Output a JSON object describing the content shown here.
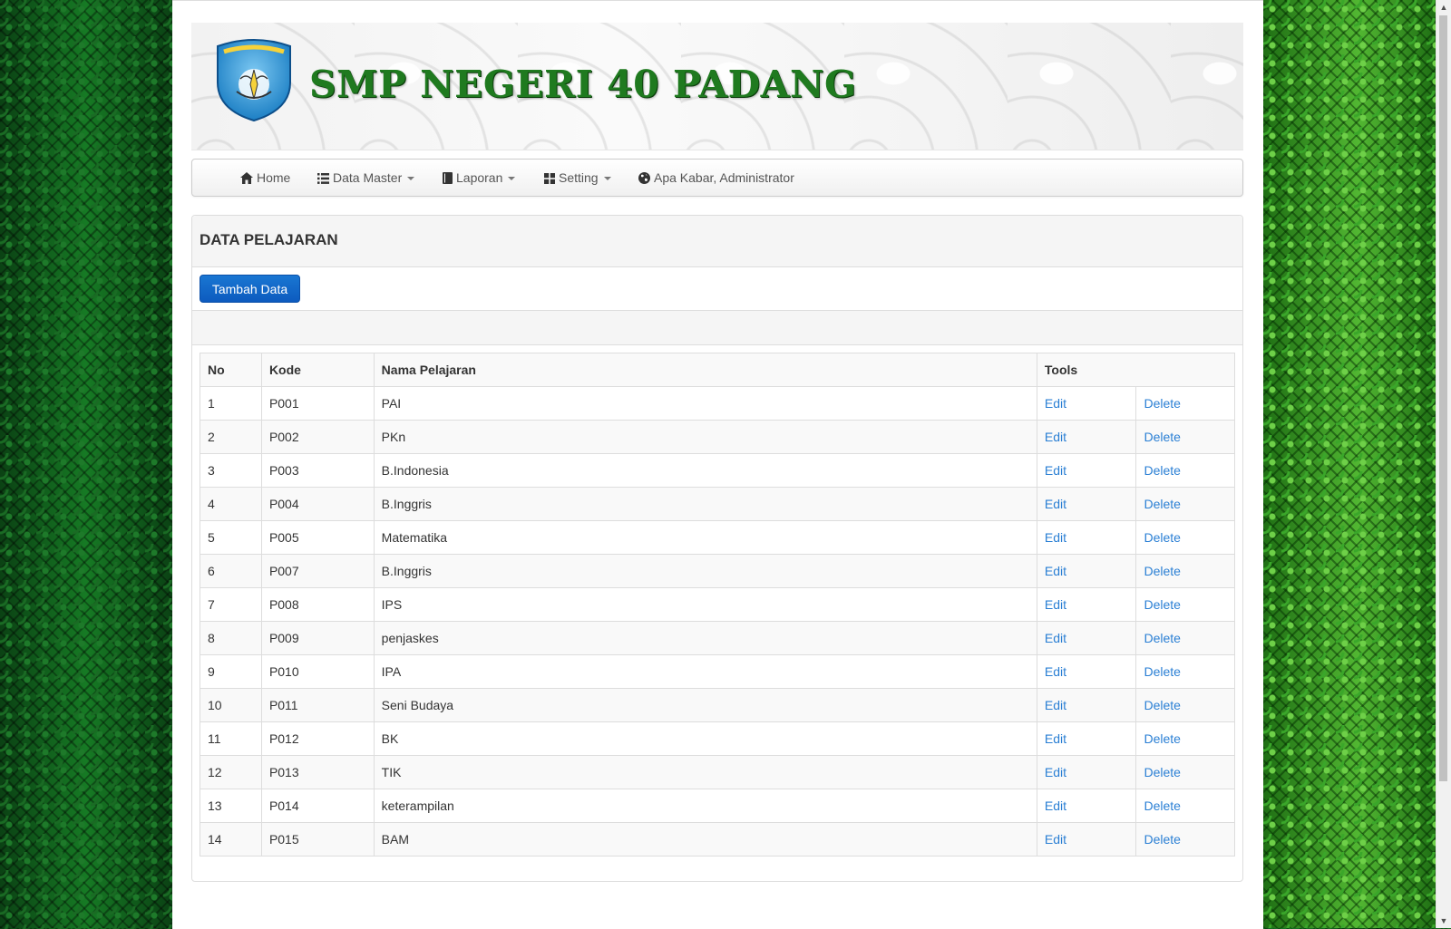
{
  "header": {
    "school_name": "SMP NEGERI 40 PADANG",
    "logo_icon": "tut-wuri-handayani-logo"
  },
  "nav": {
    "items": [
      {
        "label": "Home",
        "icon": "home-icon",
        "dropdown": false
      },
      {
        "label": "Data Master",
        "icon": "list-icon",
        "dropdown": true
      },
      {
        "label": "Laporan",
        "icon": "book-icon",
        "dropdown": true
      },
      {
        "label": "Setting",
        "icon": "grid-icon",
        "dropdown": true
      },
      {
        "label": "Apa Kabar, Administrator",
        "icon": "globe-icon",
        "dropdown": false
      }
    ]
  },
  "panel": {
    "title": "DATA PELAJARAN",
    "add_button": "Tambah Data"
  },
  "table": {
    "columns": [
      "No",
      "Kode",
      "Nama Pelajaran",
      "Tools"
    ],
    "edit_label": "Edit",
    "delete_label": "Delete",
    "rows": [
      {
        "no": "1",
        "kode": "P001",
        "nama": "PAI"
      },
      {
        "no": "2",
        "kode": "P002",
        "nama": "PKn"
      },
      {
        "no": "3",
        "kode": "P003",
        "nama": "B.Indonesia"
      },
      {
        "no": "4",
        "kode": "P004",
        "nama": "B.Inggris"
      },
      {
        "no": "5",
        "kode": "P005",
        "nama": "Matematika"
      },
      {
        "no": "6",
        "kode": "P007",
        "nama": "B.Inggris"
      },
      {
        "no": "7",
        "kode": "P008",
        "nama": "IPS"
      },
      {
        "no": "8",
        "kode": "P009",
        "nama": "penjaskes"
      },
      {
        "no": "9",
        "kode": "P010",
        "nama": "IPA"
      },
      {
        "no": "10",
        "kode": "P011",
        "nama": "Seni Budaya"
      },
      {
        "no": "11",
        "kode": "P012",
        "nama": "BK"
      },
      {
        "no": "12",
        "kode": "P013",
        "nama": "TIK"
      },
      {
        "no": "13",
        "kode": "P014",
        "nama": "keterampilan"
      },
      {
        "no": "14",
        "kode": "P015",
        "nama": "BAM"
      }
    ]
  },
  "colors": {
    "accent_green": "#1f7a1f",
    "button_blue": "#1565c0",
    "link_blue": "#2a7fd4"
  }
}
